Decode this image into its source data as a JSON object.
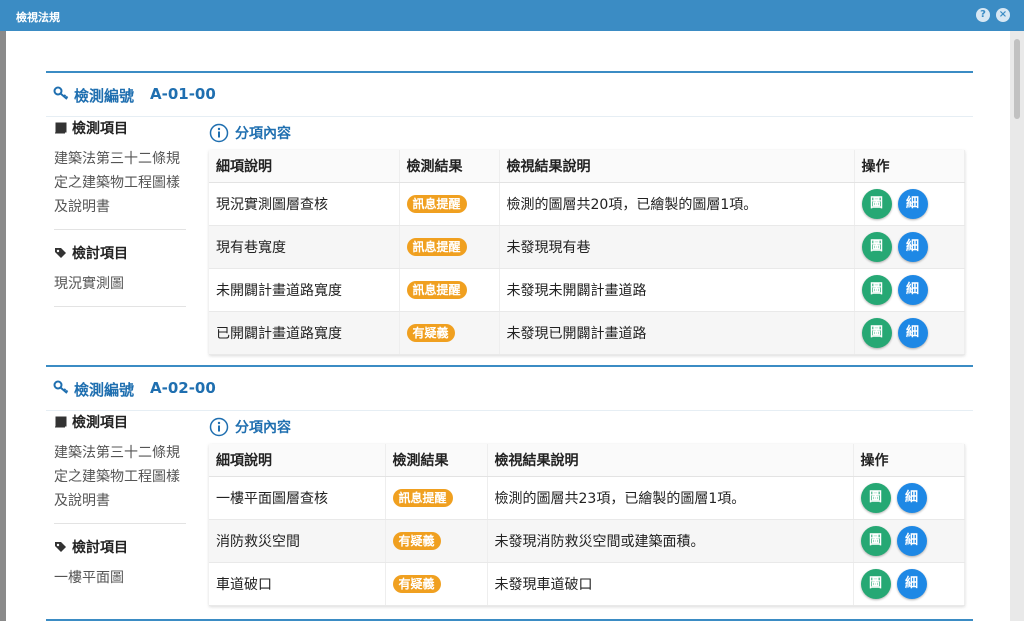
{
  "window": {
    "title": "檢視法規"
  },
  "labels": {
    "code": "檢測編號",
    "check_item": "檢測項目",
    "review_item": "檢討項目",
    "sub_content": "分項內容",
    "col_item": "細項說明",
    "col_result": "檢測結果",
    "col_desc": "檢視結果說明",
    "col_action": "操作",
    "btn_map": "圖",
    "btn_detail": "細"
  },
  "sections": [
    {
      "code": "A-01-00",
      "check_item": "建築法第三十二條規定之建築物工程圖樣及說明書",
      "review_item": "現況實測圖",
      "rows": [
        {
          "item": "現況實測圖層查核",
          "result": "訊息提醒",
          "desc": "檢測的圖層共20項，已繪製的圖層1項。"
        },
        {
          "item": "現有巷寬度",
          "result": "訊息提醒",
          "desc": "未發現現有巷"
        },
        {
          "item": "未開闢計畫道路寬度",
          "result": "訊息提醒",
          "desc": "未發現未開闢計畫道路"
        },
        {
          "item": "已開闢計畫道路寬度",
          "result": "有疑義",
          "desc": "未發現已開闢計畫道路"
        }
      ]
    },
    {
      "code": "A-02-00",
      "check_item": "建築法第三十二條規定之建築物工程圖樣及說明書",
      "review_item": "一樓平面圖",
      "rows": [
        {
          "item": "一樓平面圖層查核",
          "result": "訊息提醒",
          "desc": "檢測的圖層共23項，已繪製的圖層1項。"
        },
        {
          "item": "消防救災空間",
          "result": "有疑義",
          "desc": "未發現消防救災空間或建築面積。"
        },
        {
          "item": "車道破口",
          "result": "有疑義",
          "desc": "未發現車道破口"
        }
      ]
    }
  ]
}
